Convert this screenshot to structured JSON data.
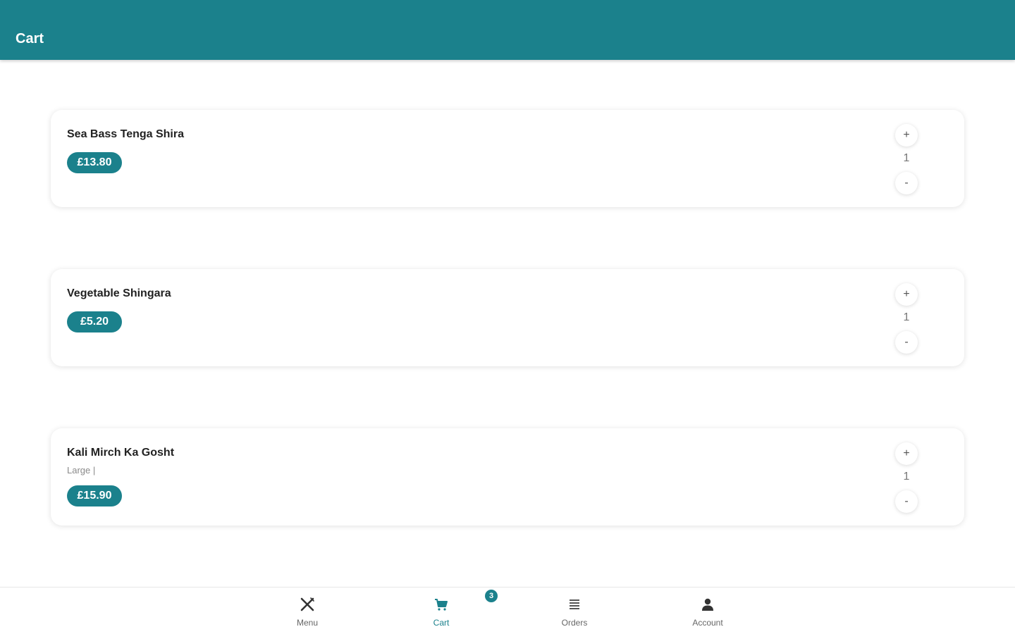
{
  "header": {
    "title": "Cart"
  },
  "cart": {
    "items": [
      {
        "name": "Sea Bass Tenga Shira",
        "options": "",
        "price": "£13.80",
        "quantity": "1",
        "plus_label": "+",
        "minus_label": "-"
      },
      {
        "name": "Vegetable Shingara",
        "options": "",
        "price": "£5.20",
        "quantity": "1",
        "plus_label": "+",
        "minus_label": "-"
      },
      {
        "name": "Kali Mirch Ka Gosht",
        "options": "Large |",
        "price": "£15.90",
        "quantity": "1",
        "plus_label": "+",
        "minus_label": "-"
      }
    ]
  },
  "nav": {
    "menu_label": "Menu",
    "cart_label": "Cart",
    "cart_badge": "3",
    "orders_label": "Orders",
    "account_label": "Account",
    "icons": {
      "menu": "utensils-icon",
      "cart": "cart-icon",
      "orders": "list-icon",
      "account": "person-icon"
    }
  },
  "colors": {
    "primary": "#1b818c",
    "text": "#222222",
    "muted": "#8a8a8a"
  }
}
